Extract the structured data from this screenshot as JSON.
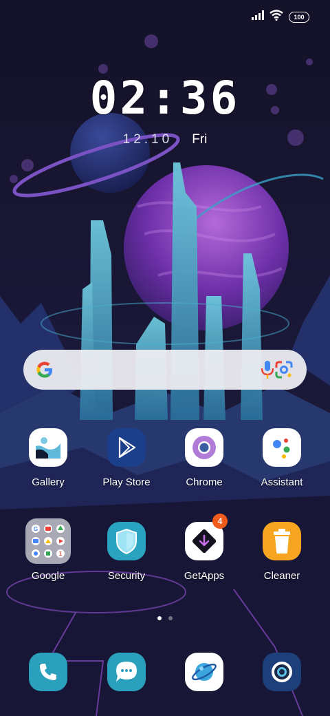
{
  "status_bar": {
    "battery": "100",
    "signal_icon": "signal-icon",
    "wifi_icon": "wifi-icon"
  },
  "clock": {
    "time": "02:36",
    "date": "12.10",
    "weekday": "Fri"
  },
  "search": {
    "google_icon": "google-g-icon",
    "mic_icon": "mic-icon",
    "lens_icon": "lens-icon"
  },
  "apps_row1": [
    {
      "label": "Gallery"
    },
    {
      "label": "Play Store"
    },
    {
      "label": "Chrome"
    },
    {
      "label": "Assistant"
    }
  ],
  "apps_row2": [
    {
      "label": "Google"
    },
    {
      "label": "Security"
    },
    {
      "label": "GetApps",
      "badge": "4"
    },
    {
      "label": "Cleaner"
    }
  ],
  "page_indicator": {
    "pages": 2,
    "active": 1
  },
  "dock": [
    {
      "icon": "phone-icon"
    },
    {
      "icon": "messages-icon"
    },
    {
      "icon": "browser-icon"
    },
    {
      "icon": "camera-icon"
    }
  ]
}
